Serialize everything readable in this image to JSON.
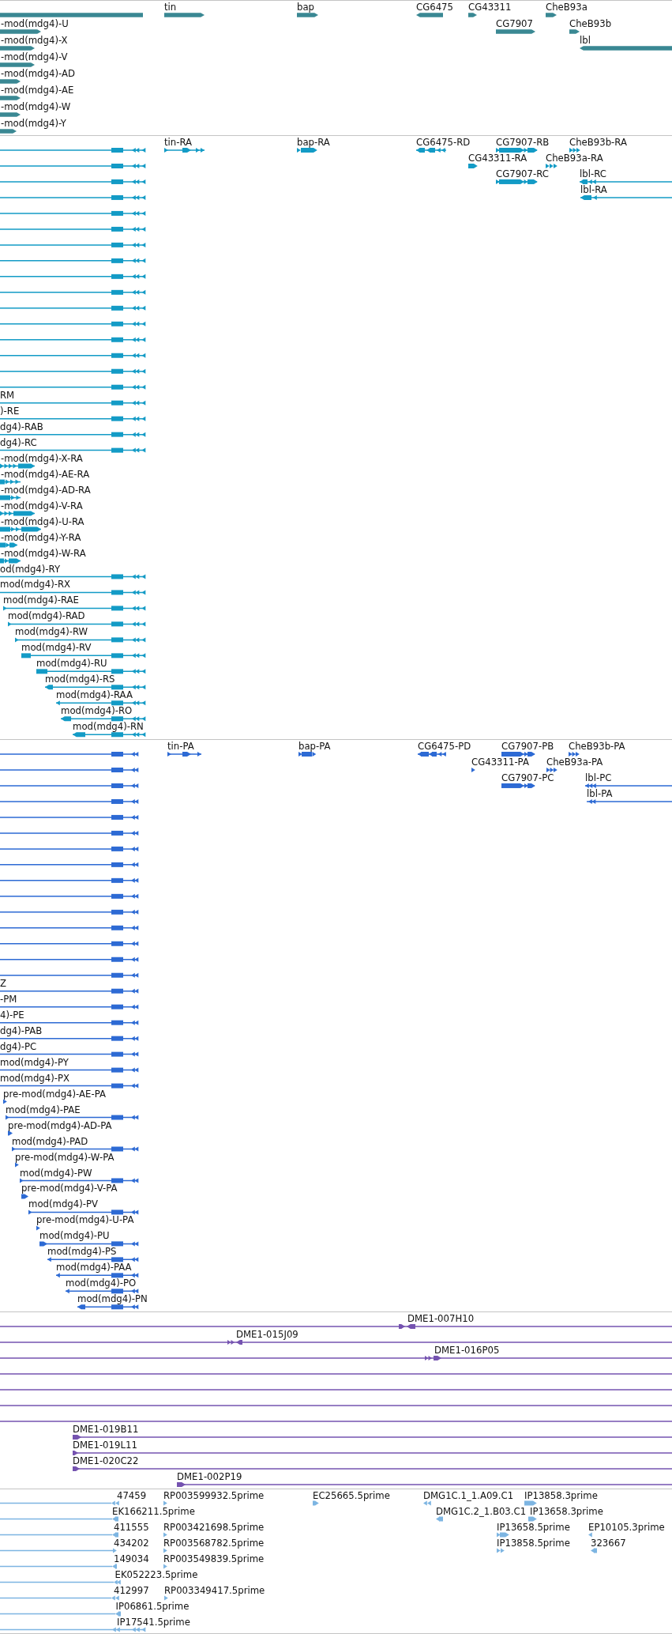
{
  "tracks": [
    {
      "kind": "gene",
      "features": [
        {
          "selected": false
        },
        {
          "label": "tin",
          "reverse": false,
          "selected": false
        },
        {
          "label": "bap",
          "reverse": false,
          "selected": false
        },
        {
          "label": "CG6475",
          "reverse": true,
          "selected": false
        },
        {
          "label": "CG43311",
          "reverse": false,
          "selected": false
        },
        {
          "label": "CheB93a",
          "reverse": false,
          "selected": false
        },
        {
          "label": "-mod(mdg4)-U",
          "reverse": false,
          "selected": false
        },
        {
          "label": "CG7907",
          "reverse": false,
          "selected": false
        },
        {
          "label": "CheB93b",
          "reverse": false,
          "selected": false
        },
        {
          "label": "-mod(mdg4)-X",
          "reverse": false,
          "selected": false
        },
        {
          "label": "lbl",
          "reverse": true,
          "selected": false
        },
        {
          "label": "-mod(mdg4)-V",
          "reverse": false,
          "selected": false
        },
        {
          "label": "-mod(mdg4)-AD",
          "reverse": false,
          "selected": false
        },
        {
          "label": "-mod(mdg4)-AE",
          "reverse": false,
          "selected": false
        },
        {
          "label": "-mod(mdg4)-W",
          "reverse": false,
          "selected": false
        },
        {
          "label": "-mod(mdg4)-Y",
          "reverse": false,
          "selected": false
        }
      ]
    },
    {
      "kind": "transcript",
      "features": [
        {
          "reverse": true,
          "selected": false
        },
        {
          "label": "tin-RA",
          "reverse": false,
          "selected": false
        },
        {
          "label": "bap-RA",
          "reverse": false,
          "selected": false
        },
        {
          "label": "CG6475-RD",
          "reverse": true,
          "selected": false
        },
        {
          "label": "CG7907-RB",
          "reverse": false,
          "selected": false
        },
        {
          "label": "CheB93b-RA",
          "reverse": false,
          "selected": false
        },
        {
          "reverse": true,
          "selected": false
        },
        {
          "label": "CG43311-RA",
          "reverse": false,
          "selected": false
        },
        {
          "label": "CheB93a-RA",
          "reverse": false,
          "selected": false
        },
        {
          "reverse": true,
          "selected": false
        },
        {
          "label": "CG7907-RC",
          "reverse": false,
          "selected": false
        },
        {
          "label": "lbl-RC",
          "reverse": true,
          "selected": false
        },
        {
          "reverse": true,
          "selected": false
        },
        {
          "label": "lbl-RA",
          "reverse": true,
          "selected": false
        },
        {
          "reverse": true,
          "selected": false
        },
        {
          "reverse": true,
          "selected": false
        },
        {
          "reverse": true,
          "selected": false
        },
        {
          "reverse": true,
          "selected": false
        },
        {
          "reverse": true,
          "selected": false
        },
        {
          "reverse": true,
          "selected": false
        },
        {
          "reverse": true,
          "selected": false
        },
        {
          "reverse": true,
          "selected": false
        },
        {
          "reverse": true,
          "selected": false
        },
        {
          "reverse": true,
          "selected": false
        },
        {
          "reverse": true,
          "selected": false
        },
        {
          "reverse": true,
          "selected": false
        },
        {
          "label": "RM",
          "reverse": true,
          "selected": false
        },
        {
          "label": ")-RE",
          "reverse": true,
          "selected": false
        },
        {
          "label": "dg4)-RAB",
          "reverse": true,
          "selected": false
        },
        {
          "label": "dg4)-RC",
          "reverse": true,
          "selected": false
        },
        {
          "label": "-mod(mdg4)-X-RA",
          "reverse": false,
          "selected": false
        },
        {
          "label": "-mod(mdg4)-AE-RA",
          "reverse": false,
          "selected": false
        },
        {
          "label": "-mod(mdg4)-AD-RA",
          "reverse": false,
          "selected": false
        },
        {
          "label": "-mod(mdg4)-V-RA",
          "reverse": false,
          "selected": false
        },
        {
          "label": "-mod(mdg4)-U-RA",
          "reverse": false,
          "selected": false
        },
        {
          "label": "-mod(mdg4)-Y-RA",
          "reverse": false,
          "selected": false
        },
        {
          "label": "-mod(mdg4)-W-RA",
          "reverse": false,
          "selected": false
        },
        {
          "label": "od(mdg4)-RY",
          "reverse": true,
          "selected": false
        },
        {
          "label": "mod(mdg4)-RX",
          "reverse": true,
          "selected": false
        },
        {
          "label": "mod(mdg4)-RAE",
          "reverse": true,
          "selected": false
        },
        {
          "label": "mod(mdg4)-RAD",
          "reverse": true,
          "selected": false
        },
        {
          "label": "mod(mdg4)-RW",
          "reverse": true,
          "selected": false
        },
        {
          "label": "mod(mdg4)-RV",
          "reverse": true,
          "selected": false
        },
        {
          "label": "mod(mdg4)-RU",
          "reverse": true,
          "selected": false
        },
        {
          "label": "mod(mdg4)-RS",
          "reverse": true,
          "selected": false
        },
        {
          "label": "mod(mdg4)-RAA",
          "reverse": true,
          "selected": false
        },
        {
          "label": "mod(mdg4)-RO",
          "reverse": true,
          "selected": false
        },
        {
          "label": "mod(mdg4)-RN",
          "reverse": true,
          "selected": false
        }
      ]
    },
    {
      "kind": "protein",
      "features": [
        {
          "reverse": true,
          "selected": false
        },
        {
          "label": "tin-PA",
          "reverse": false,
          "selected": false
        },
        {
          "label": "bap-PA",
          "reverse": false,
          "selected": false
        },
        {
          "label": "CG6475-PD",
          "reverse": true,
          "selected": false
        },
        {
          "label": "CG7907-PB",
          "reverse": false,
          "selected": false
        },
        {
          "label": "CheB93b-PA",
          "reverse": false,
          "selected": false
        },
        {
          "reverse": true,
          "selected": false
        },
        {
          "label": "CG43311-PA",
          "reverse": false,
          "selected": false
        },
        {
          "label": "CheB93a-PA",
          "reverse": false,
          "selected": false
        },
        {
          "reverse": true,
          "selected": false
        },
        {
          "label": "CG7907-PC",
          "reverse": false,
          "selected": false
        },
        {
          "label": "lbl-PC",
          "reverse": true,
          "selected": false
        },
        {
          "reverse": true,
          "selected": false
        },
        {
          "label": "lbl-PA",
          "reverse": true,
          "selected": false
        },
        {
          "reverse": true,
          "selected": false
        },
        {
          "reverse": true,
          "selected": false
        },
        {
          "reverse": true,
          "selected": false
        },
        {
          "reverse": true,
          "selected": false
        },
        {
          "reverse": true,
          "selected": false
        },
        {
          "reverse": true,
          "selected": false
        },
        {
          "reverse": true,
          "selected": false
        },
        {
          "reverse": true,
          "selected": false
        },
        {
          "reverse": true,
          "selected": false
        },
        {
          "reverse": true,
          "selected": false
        },
        {
          "reverse": true,
          "selected": false
        },
        {
          "label": "Z",
          "reverse": true,
          "selected": false
        },
        {
          "label": "-PM",
          "reverse": true,
          "selected": false
        },
        {
          "label": "4)-PE",
          "reverse": true,
          "selected": false
        },
        {
          "label": "dg4)-PAB",
          "reverse": true,
          "selected": false
        },
        {
          "label": "dg4)-PC",
          "reverse": true,
          "selected": false
        },
        {
          "label": "mod(mdg4)-PY",
          "reverse": true,
          "selected": false
        },
        {
          "label": "mod(mdg4)-PX",
          "reverse": true,
          "selected": false
        },
        {
          "label": "pre-mod(mdg4)-AE-PA",
          "reverse": false,
          "selected": false
        },
        {
          "label": "mod(mdg4)-PAE",
          "reverse": true,
          "selected": false
        },
        {
          "label": "pre-mod(mdg4)-AD-PA",
          "reverse": false,
          "selected": false
        },
        {
          "label": "mod(mdg4)-PAD",
          "reverse": true,
          "selected": false
        },
        {
          "label": "pre-mod(mdg4)-W-PA",
          "reverse": false,
          "selected": false
        },
        {
          "label": "mod(mdg4)-PW",
          "reverse": true,
          "selected": false
        },
        {
          "label": "pre-mod(mdg4)-V-PA",
          "reverse": false,
          "selected": false
        },
        {
          "label": "mod(mdg4)-PV",
          "reverse": true,
          "selected": false
        },
        {
          "label": "pre-mod(mdg4)-U-PA",
          "reverse": false,
          "selected": false
        },
        {
          "label": "mod(mdg4)-PU",
          "reverse": true,
          "selected": false
        },
        {
          "label": "mod(mdg4)-PS",
          "reverse": true,
          "selected": false
        },
        {
          "label": "mod(mdg4)-PAA",
          "reverse": true,
          "selected": false
        },
        {
          "label": "mod(mdg4)-PO",
          "reverse": true,
          "selected": false
        },
        {
          "label": "mod(mdg4)-PN",
          "reverse": true,
          "selected": false
        }
      ]
    },
    {
      "kind": "clone",
      "features": [
        {
          "label": "DME1-007H10",
          "selected": false
        },
        {
          "label": "DME1-015J09",
          "selected": false
        },
        {
          "label": "DME1-016P05",
          "selected": false
        },
        {
          "selected": false
        },
        {
          "selected": false
        },
        {
          "selected": false
        },
        {
          "selected": false
        },
        {
          "label": "DME1-019B11",
          "selected": false
        },
        {
          "label": "DME1-019L11",
          "selected": false
        },
        {
          "label": "DME1-020C22",
          "selected": false
        },
        {
          "label": "DME1-002P19",
          "selected": false
        }
      ]
    },
    {
      "kind": "est",
      "features": [
        {
          "label": "47459",
          "reverse": true,
          "selected": false
        },
        {
          "label": "RP003599932.5prime",
          "reverse": false,
          "selected": false
        },
        {
          "label": "EC25665.5prime",
          "reverse": false,
          "selected": false
        },
        {
          "label": "DMG1C.1_1.A09.C1",
          "reverse": true,
          "selected": false
        },
        {
          "label": "IP13858.3prime",
          "reverse": false,
          "selected": false
        },
        {
          "label": "EK166211.5prime",
          "reverse": true,
          "selected": false
        },
        {
          "label": "DMG1C.2_1.B03.C1",
          "reverse": true,
          "selected": false
        },
        {
          "label": "IP13658.3prime",
          "reverse": false,
          "selected": false
        },
        {
          "label": "411555",
          "reverse": true,
          "selected": false
        },
        {
          "label": "RP003421698.5prime",
          "reverse": false,
          "selected": false
        },
        {
          "label": "IP13658.5prime",
          "reverse": false,
          "selected": false
        },
        {
          "label": "EP10105.3prime",
          "reverse": true,
          "selected": false
        },
        {
          "label": "434202",
          "reverse": false,
          "selected": false
        },
        {
          "label": "RP003568782.5prime",
          "reverse": false,
          "selected": false
        },
        {
          "label": "IP13858.5prime",
          "reverse": false,
          "selected": false
        },
        {
          "label": "323667",
          "reverse": true,
          "selected": false
        },
        {
          "label": "149034",
          "reverse": true,
          "selected": false
        },
        {
          "label": "RP003549839.5prime",
          "reverse": false,
          "selected": false
        },
        {
          "label": "EK052223.5prime",
          "reverse": true,
          "selected": false
        },
        {
          "label": "412997",
          "reverse": true,
          "selected": false
        },
        {
          "label": "RP003349417.5prime",
          "reverse": false,
          "selected": false
        },
        {
          "label": "IP06861.5prime",
          "reverse": true,
          "selected": false
        },
        {
          "label": "IP17541.5prime",
          "reverse": true,
          "selected": false
        }
      ]
    }
  ]
}
